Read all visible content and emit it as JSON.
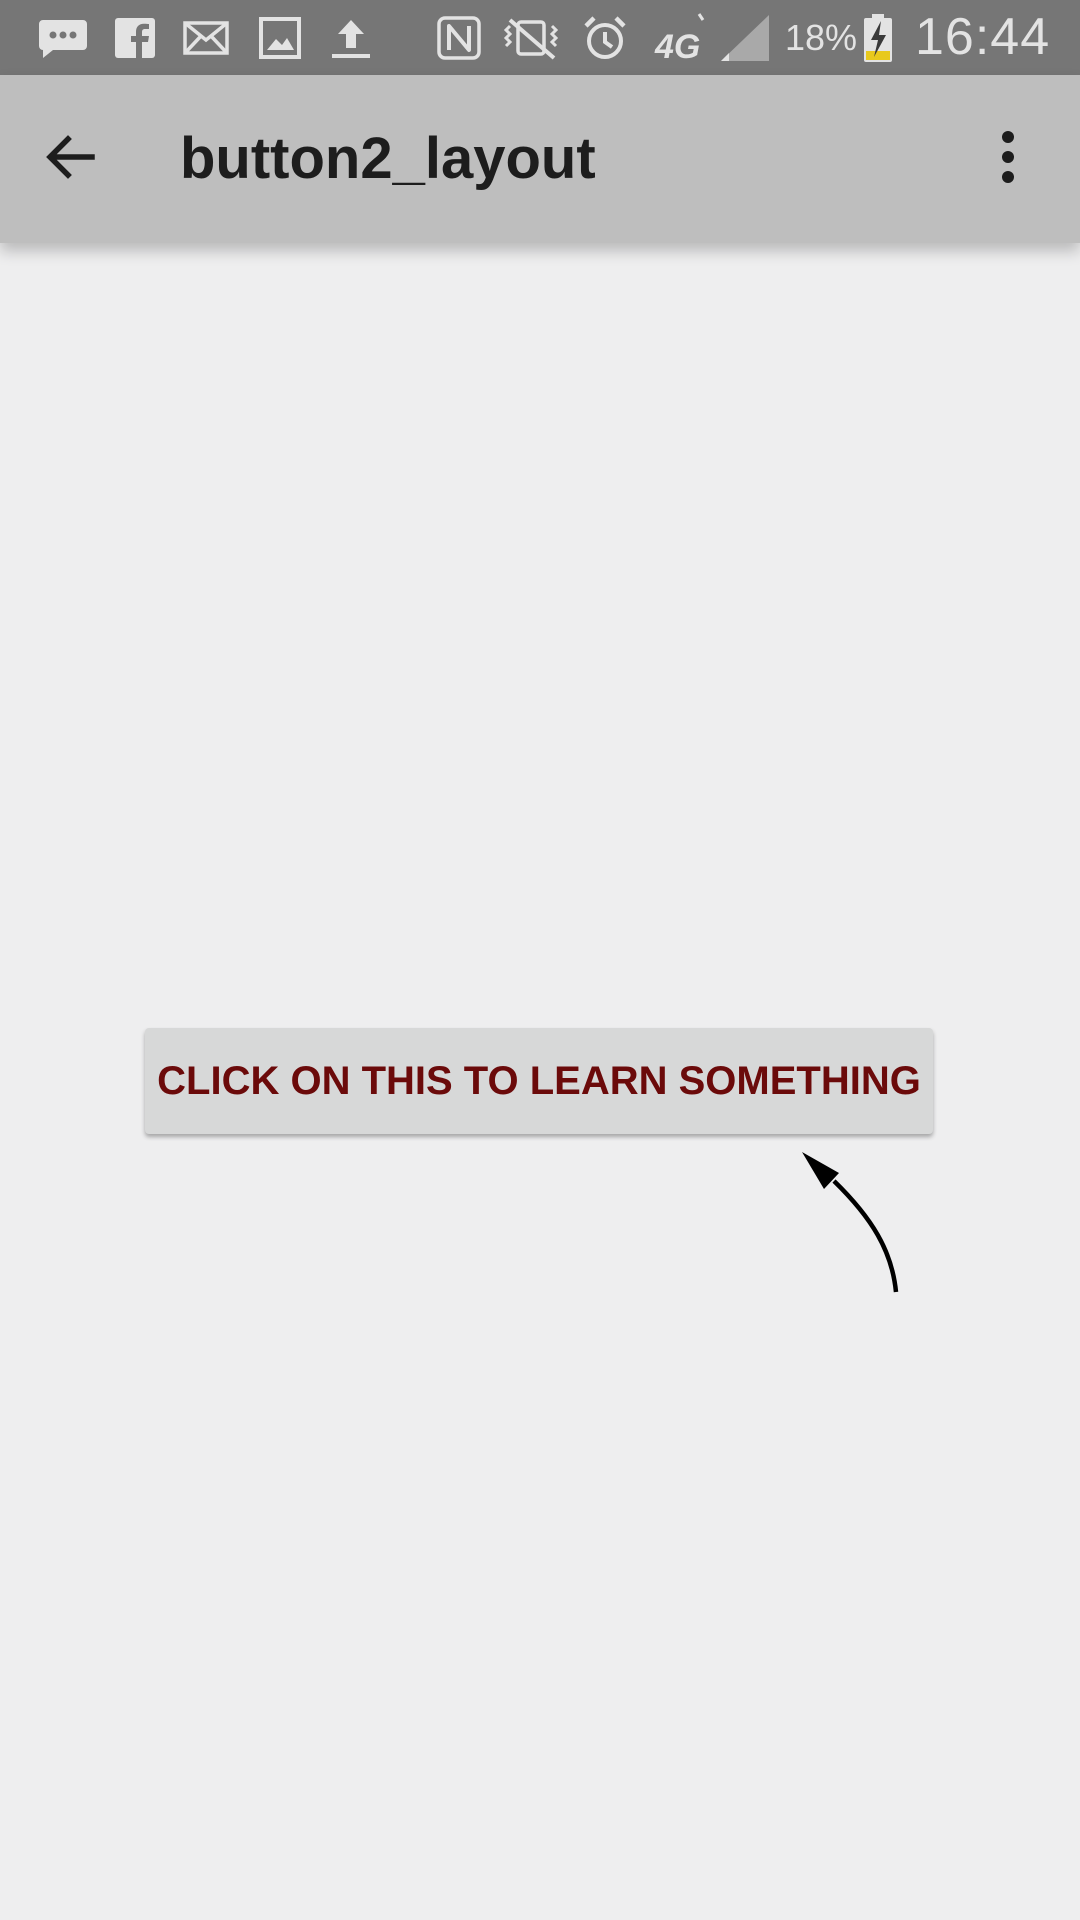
{
  "status_bar": {
    "icons": [
      "chat-bubble-icon",
      "facebook-icon",
      "mail-icon",
      "image-icon",
      "upload-icon",
      "nfc-icon",
      "vibrate-mute-icon",
      "alarm-icon",
      "network-4g-icon",
      "signal-strength-icon",
      "battery-charging-icon"
    ],
    "network_type": "4G",
    "battery_percent": "18%",
    "time": "16:44"
  },
  "app_bar": {
    "title": "button2_layout",
    "back_icon": "arrow-back-icon",
    "menu_icon": "more-vert-icon"
  },
  "content": {
    "button_label": "CLICK ON THIS TO LEARN SOMETHING",
    "hint_icon": "curved-arrow-icon"
  },
  "colors": {
    "status_bar_bg": "#767676",
    "app_bar_bg": "#bebebe",
    "content_bg": "#eeeeef",
    "button_bg": "#d7d8d8",
    "button_text": "#6b0a0a",
    "battery_level": "#e8c91c"
  }
}
